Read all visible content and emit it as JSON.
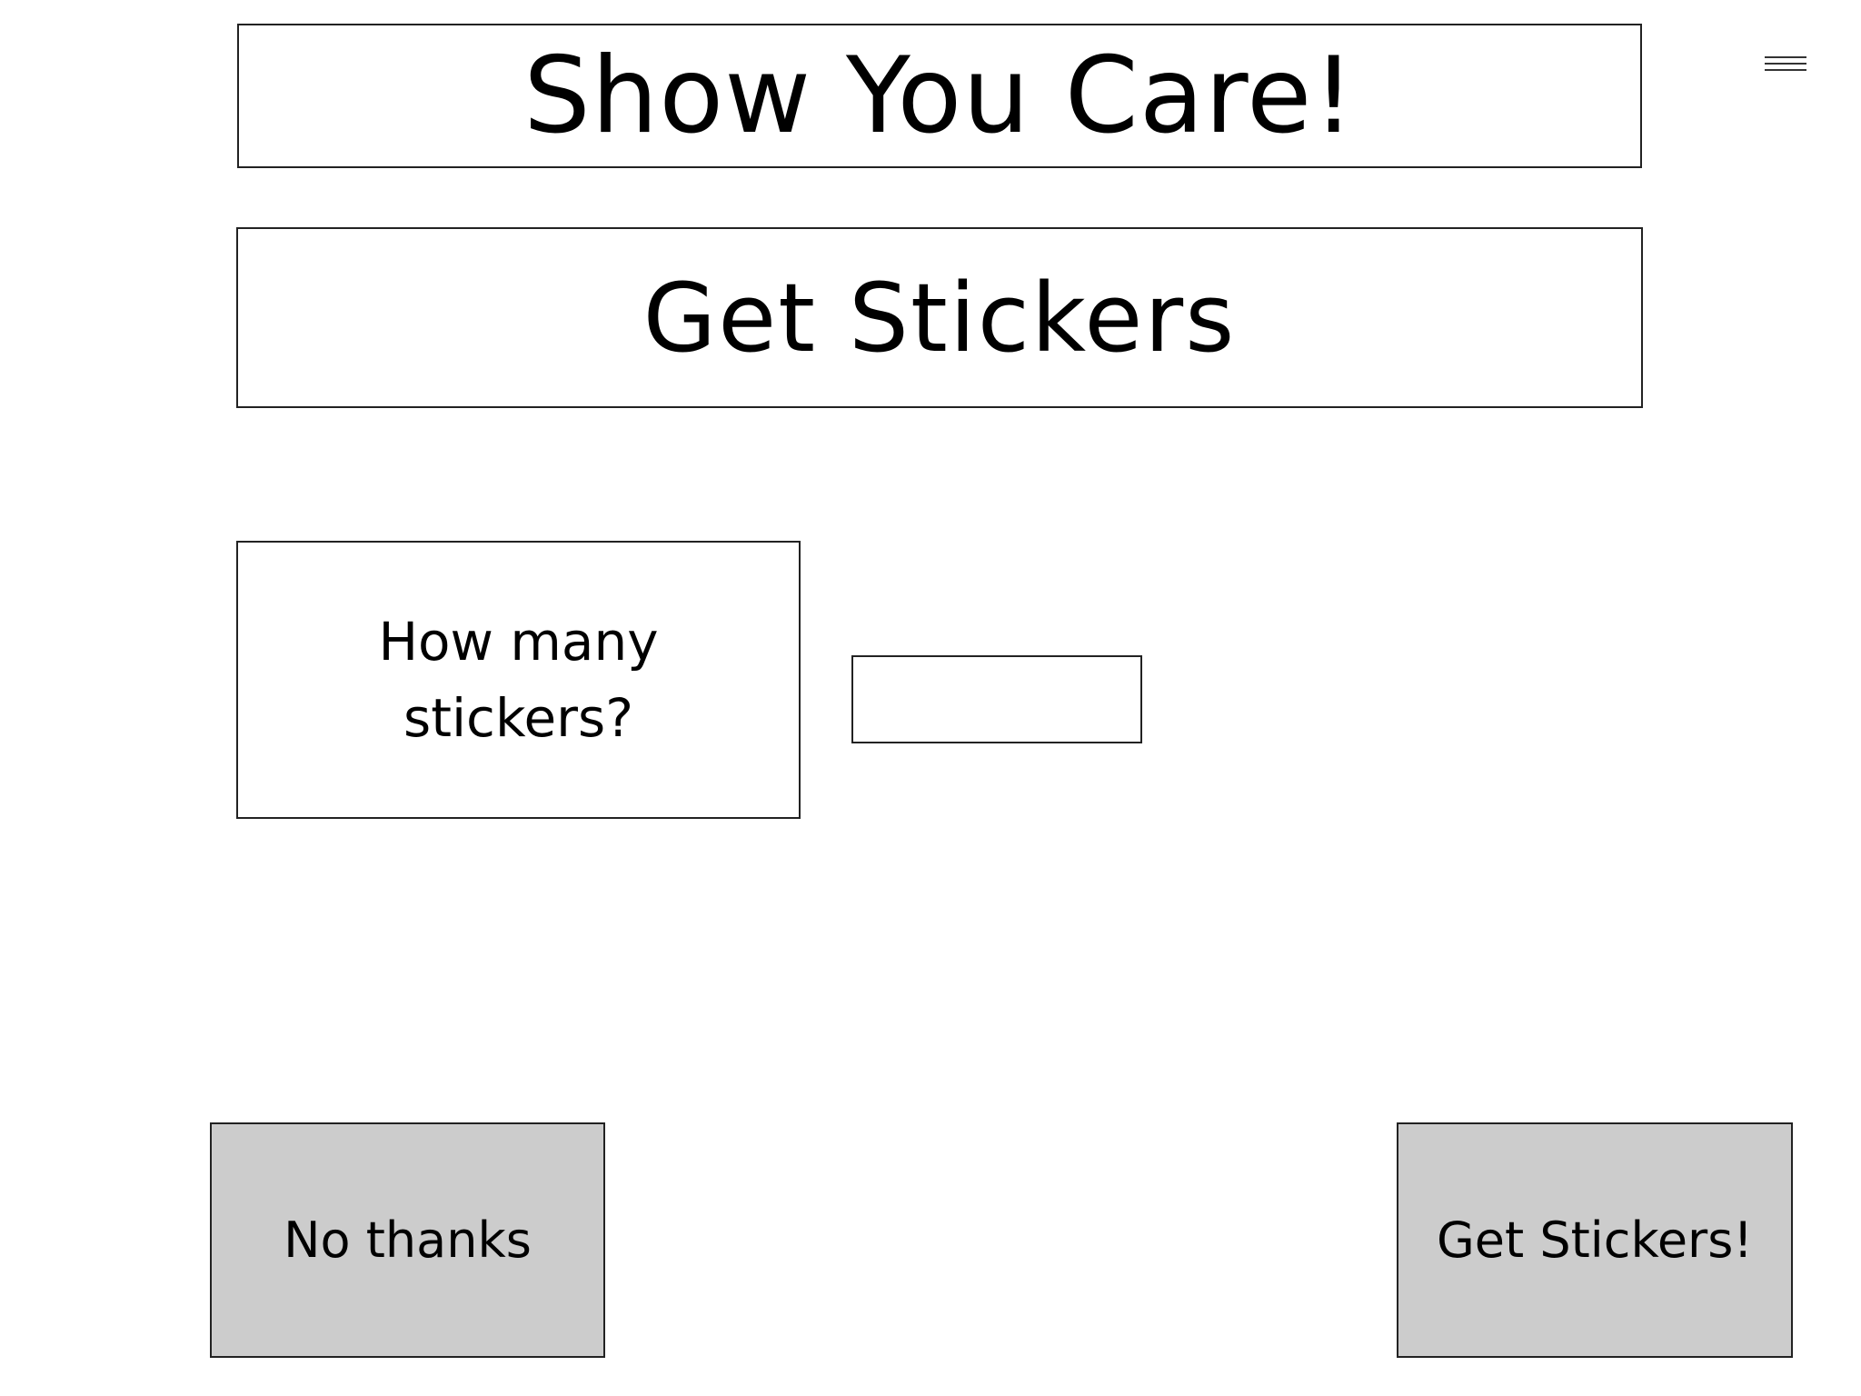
{
  "header": {
    "title": "Show You Care!",
    "subtitle": "Get Stickers"
  },
  "form": {
    "question": "How many stickers?",
    "quantity_value": ""
  },
  "actions": {
    "decline_label": "No thanks",
    "confirm_label": "Get Stickers!"
  },
  "icons": {
    "menu": "hamburger-menu-icon"
  },
  "colors": {
    "button_fill": "#cccccc",
    "border": "#222222",
    "background": "#ffffff"
  }
}
